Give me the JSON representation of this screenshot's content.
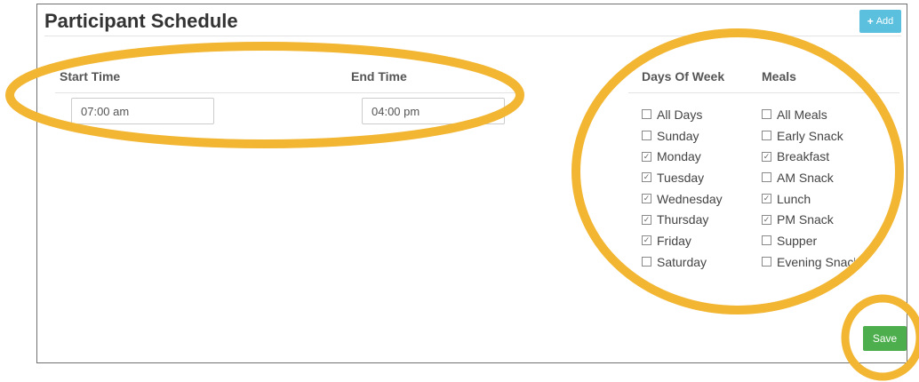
{
  "schedule": {
    "title": "Participant Schedule",
    "add_label": "Add",
    "start_time_label": "Start Time",
    "start_time_value": "07:00 am",
    "end_time_label": "End Time",
    "end_time_value": "04:00 pm",
    "days_label": "Days Of Week",
    "meals_label": "Meals",
    "days": [
      {
        "label": "All Days",
        "checked": false
      },
      {
        "label": "Sunday",
        "checked": false
      },
      {
        "label": "Monday",
        "checked": true
      },
      {
        "label": "Tuesday",
        "checked": true
      },
      {
        "label": "Wednesday",
        "checked": true
      },
      {
        "label": "Thursday",
        "checked": true
      },
      {
        "label": "Friday",
        "checked": true
      },
      {
        "label": "Saturday",
        "checked": false
      }
    ],
    "meals": [
      {
        "label": "All Meals",
        "checked": false
      },
      {
        "label": "Early Snack",
        "checked": false
      },
      {
        "label": "Breakfast",
        "checked": true
      },
      {
        "label": "AM Snack",
        "checked": false
      },
      {
        "label": "Lunch",
        "checked": true
      },
      {
        "label": "PM Snack",
        "checked": true
      },
      {
        "label": "Supper",
        "checked": false
      },
      {
        "label": "Evening Snack",
        "checked": false
      }
    ],
    "save_label": "Save"
  },
  "colors": {
    "add_button": "#5bc0de",
    "save_button": "#4cae4c",
    "highlight_outline": "#f2b632"
  },
  "icons": {
    "add": "plus-icon",
    "checkbox_checked": "checkbox-checked-icon",
    "checkbox_unchecked": "checkbox-unchecked-icon"
  }
}
